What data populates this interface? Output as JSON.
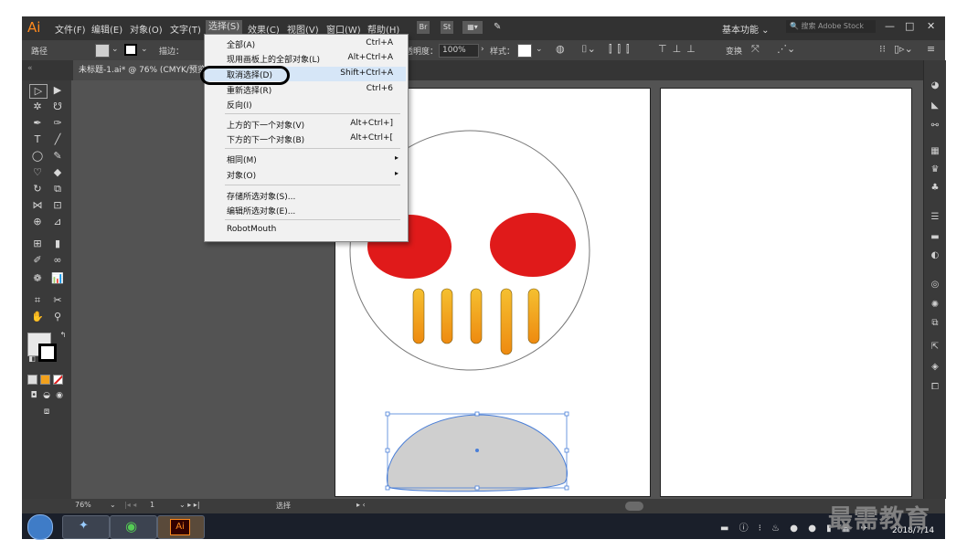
{
  "app": {
    "logo": "Ai",
    "menu": [
      "文件(F)",
      "编辑(E)",
      "对象(O)",
      "文字(T)",
      "选择(S)",
      "效果(C)",
      "视图(V)",
      "窗口(W)",
      "帮助(H)"
    ],
    "workspace": "基本功能",
    "search_placeholder": "搜索 Adobe Stock",
    "window_buttons": [
      "—",
      "□",
      "✕"
    ]
  },
  "control_bar": {
    "object_type": "路径",
    "stroke_label": "描边：",
    "opacity_label": "不透明度：",
    "opacity_value": "100%",
    "style_label": "样式：",
    "transform_label": "变换"
  },
  "document_tab": {
    "label": "未标题-1.ai* @ 76% (CMYK/预览)"
  },
  "select_menu": {
    "items": [
      {
        "label": "全部(A)",
        "shortcut": "Ctrl+A"
      },
      {
        "label": "现用画板上的全部对象(L)",
        "shortcut": "Alt+Ctrl+A"
      },
      {
        "label": "取消选择(D)",
        "shortcut": "Shift+Ctrl+A"
      },
      {
        "label": "重新选择(R)",
        "shortcut": "Ctrl+6"
      },
      {
        "label": "反向(I)",
        "shortcut": ""
      },
      {
        "label": "上方的下一个对象(V)",
        "shortcut": "Alt+Ctrl+]"
      },
      {
        "label": "下方的下一个对象(B)",
        "shortcut": "Alt+Ctrl+["
      },
      {
        "label": "相同(M)",
        "shortcut": ""
      },
      {
        "label": "对象(O)",
        "shortcut": ""
      },
      {
        "label": "存储所选对象(S)...",
        "shortcut": ""
      },
      {
        "label": "编辑所选对象(E)...",
        "shortcut": ""
      },
      {
        "label": "RobotMouth",
        "shortcut": ""
      }
    ],
    "submenu_arrow": "▸"
  },
  "status_bar": {
    "zoom": "76%",
    "artboard_num": "1",
    "tool": "选择"
  },
  "taskbar": {
    "ai_label": "Ai",
    "date": "2018/7/14"
  },
  "watermark": "最需教育",
  "colors": {
    "eye_red": "#e01a1a",
    "teeth_orange": "#f2a11c",
    "mouth_gray": "#cfcfcf",
    "selection_blue": "#4a7fd8"
  }
}
